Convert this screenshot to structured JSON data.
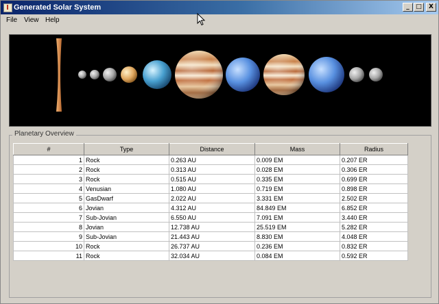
{
  "window": {
    "title": "Generated Solar System",
    "buttons": {
      "minimize": "_",
      "maximize": "□",
      "close": "X"
    }
  },
  "menu": [
    "File",
    "View",
    "Help"
  ],
  "overview": {
    "label": "Planetary Overview",
    "columns": [
      "#",
      "Type",
      "Distance",
      "Mass",
      "Radius"
    ],
    "rows": [
      [
        "1",
        "Rock",
        "0.263 AU",
        "0.009 EM",
        "0.207 ER"
      ],
      [
        "2",
        "Rock",
        "0.313 AU",
        "0.028 EM",
        "0.306 ER"
      ],
      [
        "3",
        "Rock",
        "0.515 AU",
        "0.335 EM",
        "0.699 ER"
      ],
      [
        "4",
        "Venusian",
        "1.080 AU",
        "0.719 EM",
        "0.898 ER"
      ],
      [
        "5",
        "GasDwarf",
        "2.022 AU",
        "3.331 EM",
        "2.502 ER"
      ],
      [
        "6",
        "Jovian",
        "4.312 AU",
        "84.849 EM",
        "6.852 ER"
      ],
      [
        "7",
        "Sub-Jovian",
        "6.550 AU",
        "7.091 EM",
        "3.440 ER"
      ],
      [
        "8",
        "Jovian",
        "12.738 AU",
        "25.519 EM",
        "5.282 ER"
      ],
      [
        "9",
        "Sub-Jovian",
        "21.443 AU",
        "8.830 EM",
        "4.048 ER"
      ],
      [
        "10",
        "Rock",
        "26.737 AU",
        "0.236 EM",
        "0.832 ER"
      ],
      [
        "11",
        "Rock",
        "32.034 AU",
        "0.084 EM",
        "0.592 ER"
      ]
    ]
  },
  "planets_view": [
    {
      "kind": "sun-edge"
    },
    {
      "kind": "rock"
    },
    {
      "kind": "rock"
    },
    {
      "kind": "rock"
    },
    {
      "kind": "venusian"
    },
    {
      "kind": "gas-dwarf"
    },
    {
      "kind": "jovian"
    },
    {
      "kind": "sub-jovian"
    },
    {
      "kind": "jovian"
    },
    {
      "kind": "sub-jovian"
    },
    {
      "kind": "rock"
    },
    {
      "kind": "rock"
    }
  ],
  "colors": {
    "title_start": "#0a246a",
    "title_end": "#a6caf0",
    "rock": "#b8b8b8",
    "venusian": "#e0b070",
    "gas_dwarf": "#4aa0d8",
    "jovian": "#c87840",
    "sub_jovian": "#5590e0",
    "sun": "#d8904a"
  }
}
